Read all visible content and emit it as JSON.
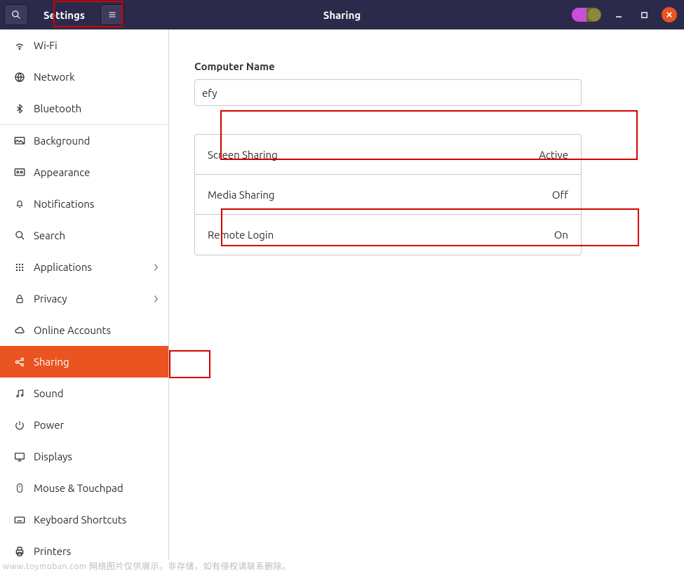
{
  "header": {
    "app_title": "Settings",
    "page_title": "Sharing"
  },
  "sidebar": {
    "items": [
      {
        "label": "Wi-Fi",
        "icon": "wifi-icon"
      },
      {
        "label": "Network",
        "icon": "globe-icon"
      },
      {
        "label": "Bluetooth",
        "icon": "bluetooth-icon"
      },
      {
        "label": "Background",
        "icon": "background-icon"
      },
      {
        "label": "Appearance",
        "icon": "appearance-icon"
      },
      {
        "label": "Notifications",
        "icon": "bell-icon"
      },
      {
        "label": "Search",
        "icon": "search-icon"
      },
      {
        "label": "Applications",
        "icon": "grid-icon",
        "chevron": true
      },
      {
        "label": "Privacy",
        "icon": "lock-icon",
        "chevron": true
      },
      {
        "label": "Online Accounts",
        "icon": "cloud-icon"
      },
      {
        "label": "Sharing",
        "icon": "share-icon",
        "active": true
      },
      {
        "label": "Sound",
        "icon": "music-icon"
      },
      {
        "label": "Power",
        "icon": "power-icon"
      },
      {
        "label": "Displays",
        "icon": "display-icon"
      },
      {
        "label": "Mouse & Touchpad",
        "icon": "mouse-icon"
      },
      {
        "label": "Keyboard Shortcuts",
        "icon": "keyboard-icon"
      },
      {
        "label": "Printers",
        "icon": "printer-icon"
      }
    ]
  },
  "main": {
    "computer_name_label": "Computer Name",
    "computer_name_value": "efy",
    "options": [
      {
        "label": "Screen Sharing",
        "status": "Active"
      },
      {
        "label": "Media Sharing",
        "status": "Off"
      },
      {
        "label": "Remote Login",
        "status": "On"
      }
    ]
  },
  "footer": {
    "text": "www.toymoban.com  网络图片仅供展示，非存储，如有侵权请联系删除。"
  }
}
